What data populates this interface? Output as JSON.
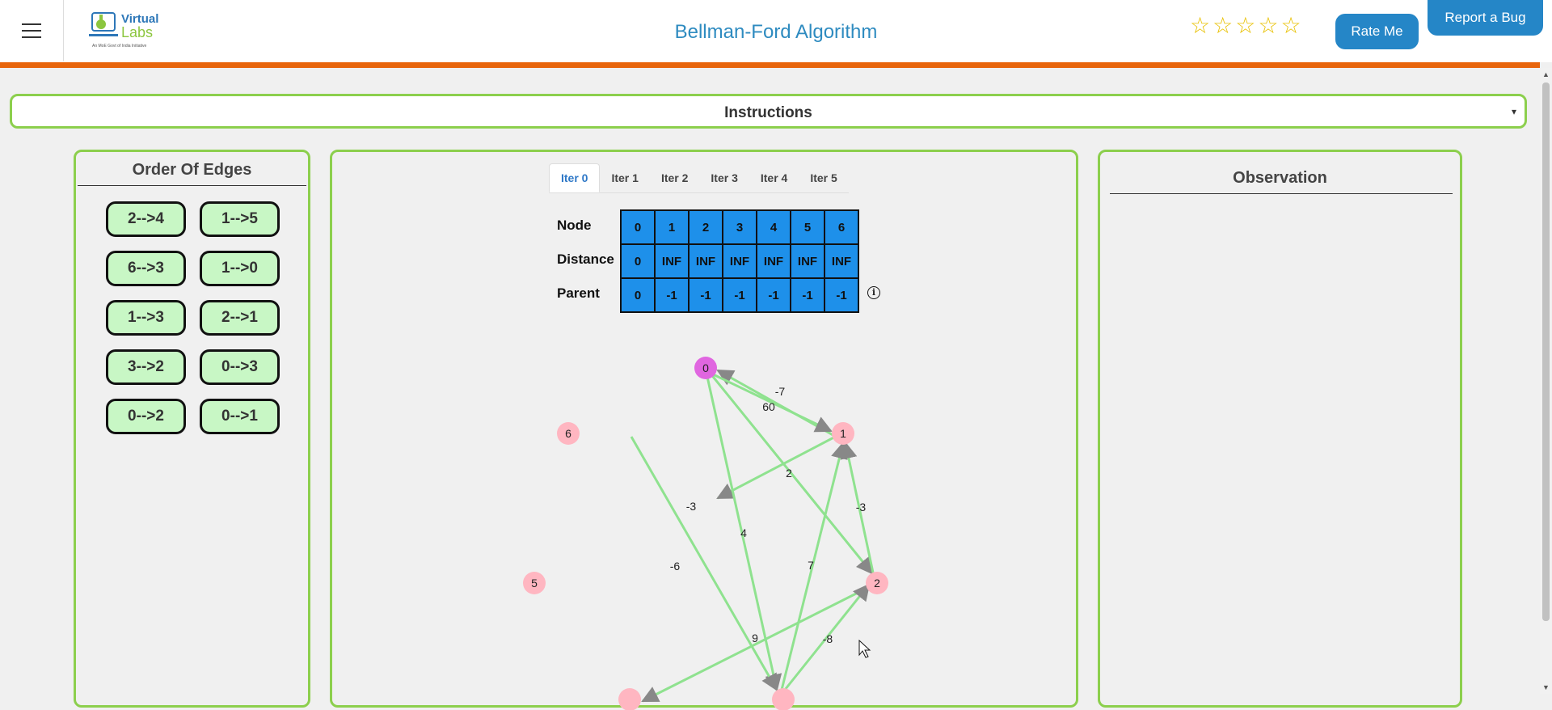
{
  "header": {
    "menu_icon": "hamburger-icon",
    "logo": {
      "line1": "Virtual",
      "line2": "Labs",
      "tagline": "An MoE Govt of India Initiative"
    },
    "title": "Bellman-Ford Algorithm",
    "rating_stars": [
      "☆",
      "☆",
      "☆",
      "☆",
      "☆"
    ],
    "rate_label": "Rate Me",
    "bug_label": "Report a Bug"
  },
  "instructions": {
    "label": "Instructions",
    "caret": "▾"
  },
  "order_panel": {
    "title": "Order Of Edges",
    "edges": [
      "2-->4",
      "1-->5",
      "6-->3",
      "1-->0",
      "1-->3",
      "2-->1",
      "3-->2",
      "0-->3",
      "0-->2",
      "0-->1"
    ]
  },
  "iterations": {
    "tabs": [
      "Iter 0",
      "Iter 1",
      "Iter 2",
      "Iter 3",
      "Iter 4",
      "Iter 5"
    ],
    "active": 0,
    "row_labels": [
      "Node",
      "Distance",
      "Parent"
    ],
    "nodes": [
      "0",
      "1",
      "2",
      "3",
      "4",
      "5",
      "6"
    ],
    "distance": [
      "0",
      "INF",
      "INF",
      "INF",
      "INF",
      "INF",
      "INF"
    ],
    "parent": [
      "0",
      "-1",
      "-1",
      "-1",
      "-1",
      "-1",
      "-1"
    ],
    "info_icon": "ⓘ"
  },
  "graph": {
    "nodes": [
      {
        "id": "0",
        "fill": "#e066e0"
      },
      {
        "id": "1",
        "fill": "#ffb6c1"
      },
      {
        "id": "2",
        "fill": "#ffb6c1"
      },
      {
        "id": "5",
        "fill": "#ffb6c1"
      },
      {
        "id": "6",
        "fill": "#ffb6c1"
      }
    ],
    "edge_weights": [
      "-7",
      "60",
      "2",
      "-3",
      "-3",
      "4",
      "-6",
      "7",
      "9",
      "-8"
    ],
    "edge_color": "#8fe28f"
  },
  "observation_panel": {
    "title": "Observation"
  },
  "colors": {
    "accent_green": "#8ccf4d",
    "brand_blue": "#2586c7",
    "orange_bar": "#e8650c",
    "table_blue": "#1e90ea"
  }
}
